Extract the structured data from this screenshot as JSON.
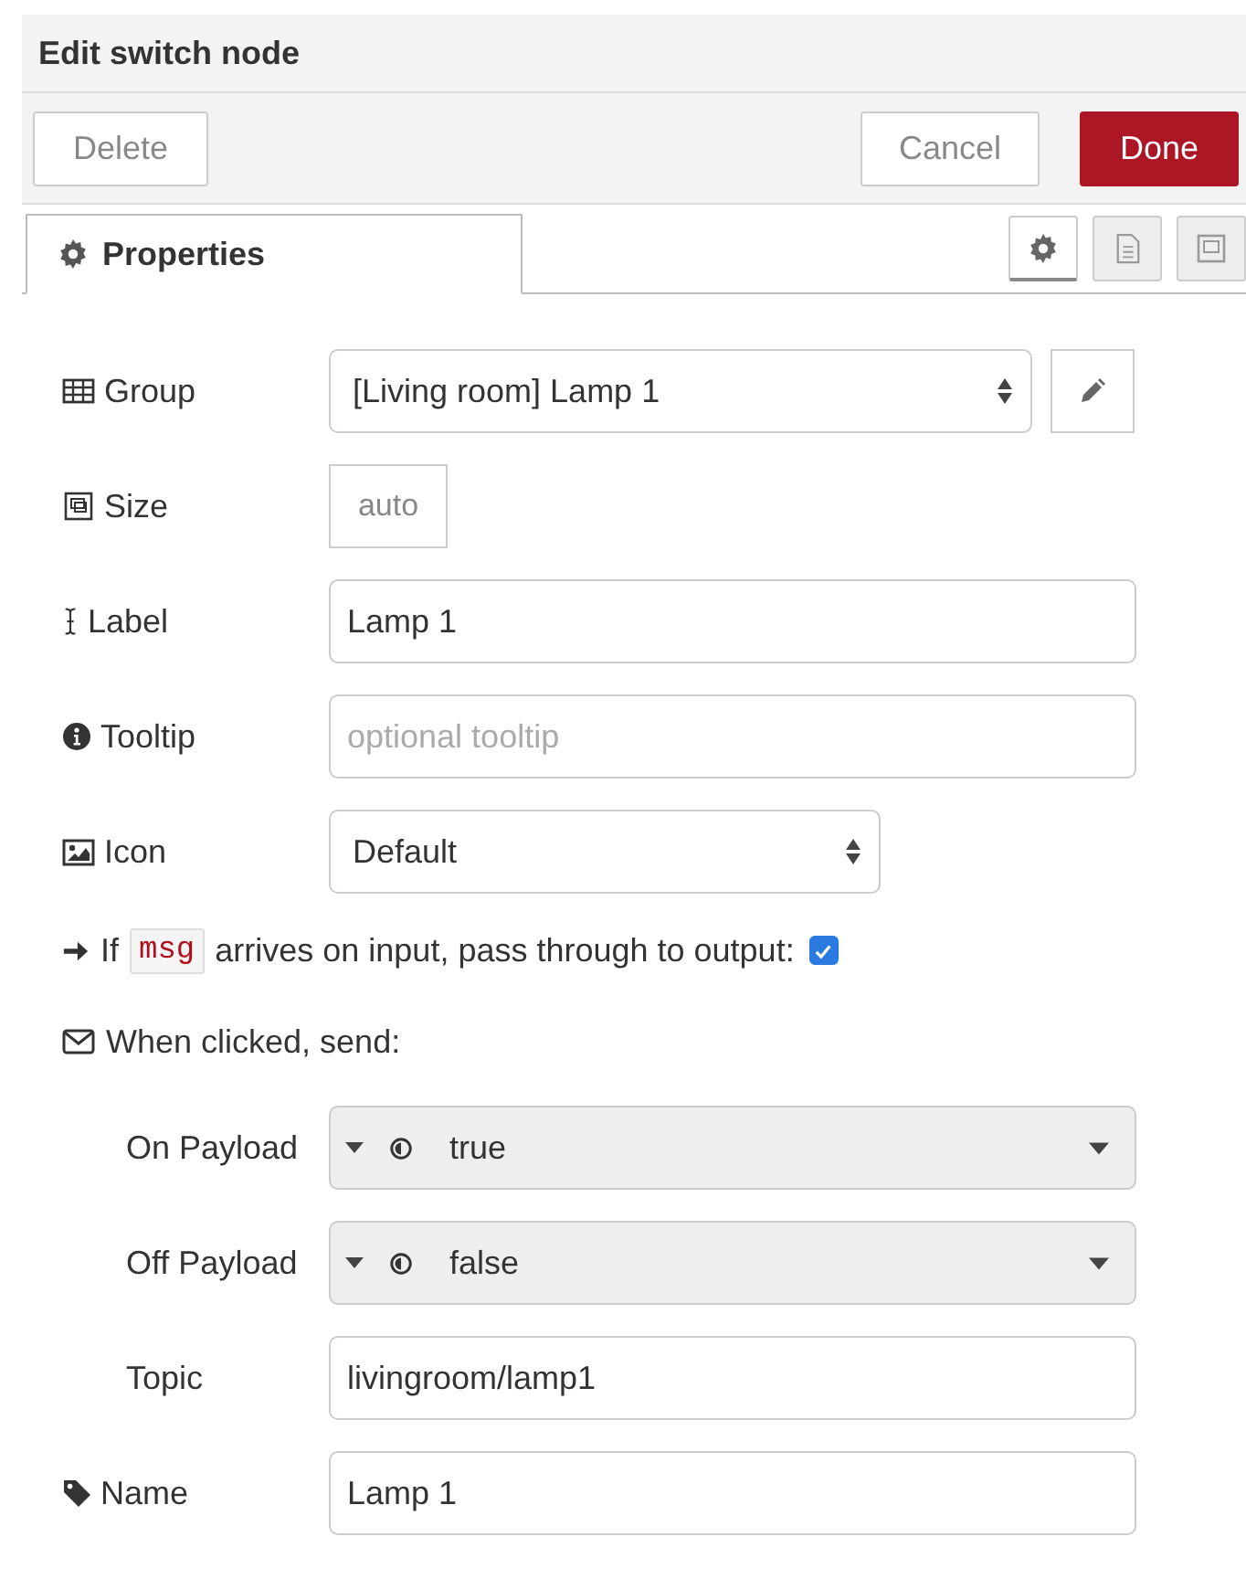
{
  "window": {
    "title": "Edit switch node"
  },
  "toolbar": [
    {
      "label": "Delete",
      "kind": "plain"
    },
    {
      "label": "Cancel",
      "kind": "plain"
    },
    {
      "label": "Done",
      "kind": "primary"
    }
  ],
  "tabs": [
    {
      "label": "Properties",
      "selected": true
    }
  ],
  "tab_icons": [
    {
      "kind": "gear",
      "selected": true
    },
    {
      "kind": "document",
      "selected": false
    },
    {
      "kind": "size",
      "selected": false
    }
  ],
  "rows": [
    {
      "kind": "select-edit",
      "label": "Group",
      "value": "[Living room] Lamp 1"
    },
    {
      "kind": "size",
      "label": "Size",
      "value": "auto"
    },
    {
      "kind": "text",
      "label": "Label",
      "value": "Lamp 1"
    },
    {
      "kind": "text",
      "label": "Tooltip",
      "placeholder": "optional tooltip"
    },
    {
      "kind": "select",
      "label": "Icon",
      "value": "Default"
    },
    {
      "kind": "check",
      "before": "If",
      "code": "msg",
      "after": "arrives on input, pass through to output:",
      "checked": true
    },
    {
      "kind": "heading",
      "label": "When clicked, send:",
      "children": [
        {
          "kind": "typed",
          "label": "On Payload",
          "value": "true"
        },
        {
          "kind": "typed",
          "label": "Off Payload",
          "value": "false"
        },
        {
          "kind": "text",
          "label": "Topic",
          "value": "livingroom/lamp1"
        }
      ]
    },
    {
      "kind": "text",
      "label": "Name",
      "value": "Lamp 1"
    }
  ]
}
